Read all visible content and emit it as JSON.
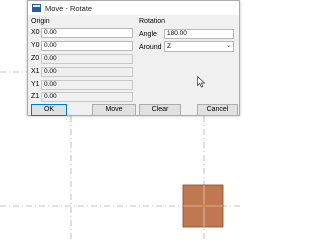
{
  "window": {
    "title": "Move - Rotate"
  },
  "origin": {
    "heading": "Origin",
    "rows": [
      {
        "label": "X0",
        "value": "0.00"
      },
      {
        "label": "Y0",
        "value": "0.00"
      },
      {
        "label": "Z0",
        "value": "0.00"
      },
      {
        "label": "X1",
        "value": "0.00"
      },
      {
        "label": "Y1",
        "value": "0.00"
      },
      {
        "label": "Z1",
        "value": "0.00"
      }
    ]
  },
  "rotation": {
    "heading": "Rotation",
    "angle_label": "Angle",
    "angle_value": "180.00",
    "around_label": "Around",
    "around_value": "Z"
  },
  "buttons": {
    "ok": "OK",
    "move": "Move",
    "clear": "Clear",
    "cancel": "Cancel"
  },
  "colors": {
    "guide_lines": "#b0b0b0",
    "square_fill": "#c07850",
    "square_border": "#8a4a28",
    "square_center": "#f08020"
  }
}
